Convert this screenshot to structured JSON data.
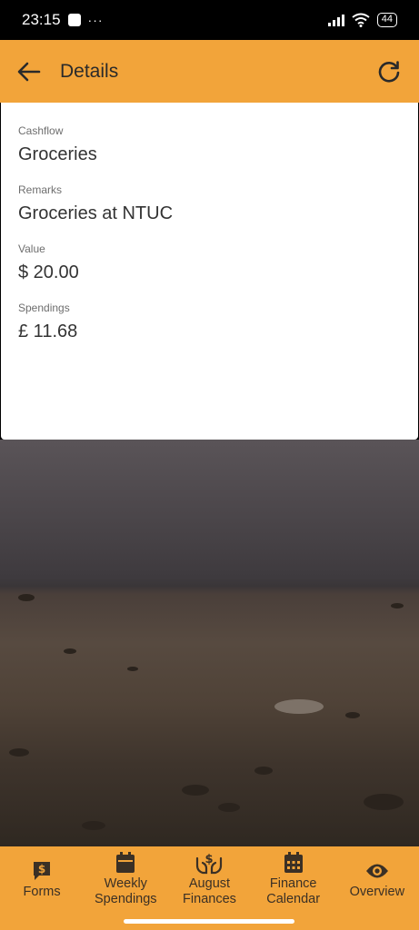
{
  "status_bar": {
    "time": "23:15",
    "dots": "···",
    "battery": "44"
  },
  "app_bar": {
    "title": "Details",
    "back_icon": "arrow-left-icon",
    "refresh_icon": "refresh-icon"
  },
  "details": [
    {
      "label": "Cashflow",
      "value": "Groceries"
    },
    {
      "label": "Remarks",
      "value": "Groceries at NTUC"
    },
    {
      "label": "Value",
      "value": "$ 20.00"
    },
    {
      "label": "Spendings",
      "value": "£ 11.68"
    }
  ],
  "bottom_nav": [
    {
      "label": "Forms",
      "icon": "dollar-message-icon"
    },
    {
      "label": "Weekly Spendings",
      "icon": "calendar-icon"
    },
    {
      "label": "August Finances",
      "icon": "hand-dollar-icon"
    },
    {
      "label": "Finance Calendar",
      "icon": "calendar-grid-icon"
    },
    {
      "label": "Overview",
      "icon": "eye-icon"
    }
  ],
  "colors": {
    "primary": "#F2A43A",
    "text": "#333333"
  }
}
